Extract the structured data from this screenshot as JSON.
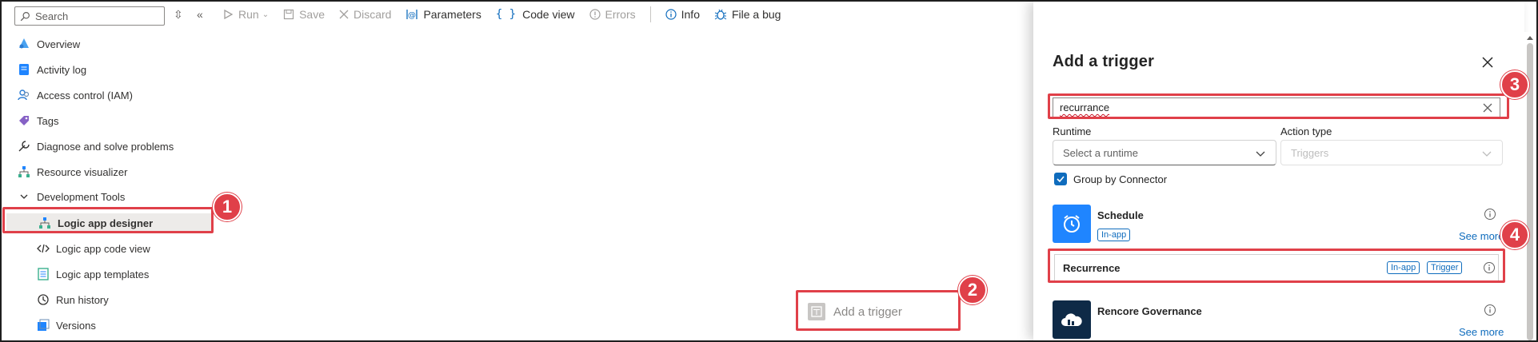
{
  "sidebar": {
    "search_placeholder": "Search",
    "items": [
      {
        "label": "Overview"
      },
      {
        "label": "Activity log"
      },
      {
        "label": "Access control (IAM)"
      },
      {
        "label": "Tags"
      },
      {
        "label": "Diagnose and solve problems"
      },
      {
        "label": "Resource visualizer"
      },
      {
        "label": "Development Tools"
      },
      {
        "label": "Logic app designer"
      },
      {
        "label": "Logic app code view"
      },
      {
        "label": "Logic app templates"
      },
      {
        "label": "Run history"
      },
      {
        "label": "Versions"
      }
    ]
  },
  "toolbar": {
    "run": "Run",
    "save": "Save",
    "discard": "Discard",
    "parameters": "Parameters",
    "code_view": "Code view",
    "errors": "Errors",
    "info": "Info",
    "file_bug": "File a bug"
  },
  "canvas": {
    "add_trigger": "Add a trigger"
  },
  "panel": {
    "title": "Add a trigger",
    "search_value": "recurrance",
    "runtime_label": "Runtime",
    "runtime_value": "Select a runtime",
    "action_type_label": "Action type",
    "action_type_value": "Triggers",
    "group_by": "Group by Connector",
    "connectors": [
      {
        "name": "Schedule",
        "badge": "In-app",
        "see_more": "See more",
        "color": "#1f85ff"
      },
      {
        "name": "Rencore Governance",
        "see_more": "See more",
        "color": "#0e2a47"
      }
    ],
    "recurrence": {
      "name": "Recurrence",
      "badge_inapp": "In-app",
      "badge_trigger": "Trigger"
    }
  },
  "callouts": [
    "1",
    "2",
    "3",
    "4"
  ],
  "colors": {
    "accent": "#0f6cbd",
    "highlight": "#e04049"
  }
}
